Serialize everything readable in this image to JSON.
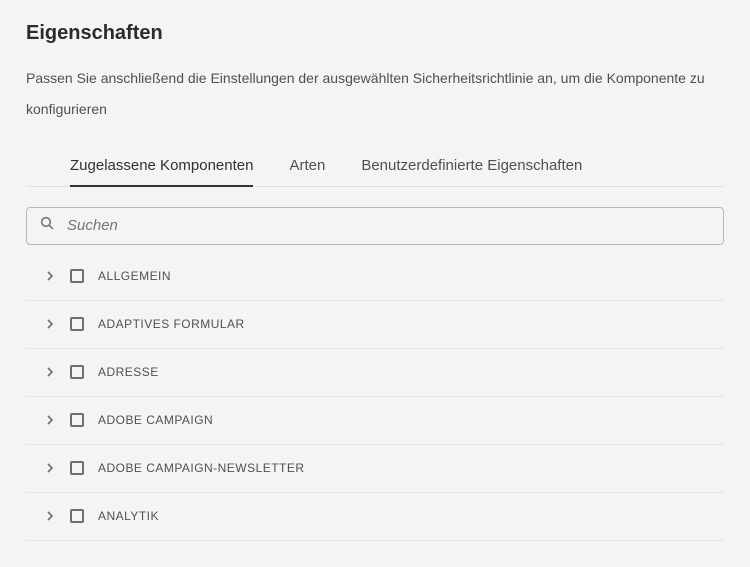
{
  "header": {
    "title": "Eigenschaften",
    "description": "Passen Sie anschließend die Einstellungen der ausgewählten Sicherheitsrichtlinie an, um die Komponente zu konfigurieren"
  },
  "tabs": [
    {
      "label": "Zugelassene Komponenten",
      "active": true
    },
    {
      "label": "Arten",
      "active": false
    },
    {
      "label": "Benutzerdefinierte Eigenschaften",
      "active": false
    }
  ],
  "search": {
    "placeholder": "Suchen",
    "value": ""
  },
  "groups": [
    {
      "label": "ALLGEMEIN"
    },
    {
      "label": "ADAPTIVES FORMULAR"
    },
    {
      "label": "ADRESSE"
    },
    {
      "label": "ADOBE CAMPAIGN"
    },
    {
      "label": "ADOBE CAMPAIGN-NEWSLETTER"
    },
    {
      "label": "ANALYTIK"
    }
  ]
}
